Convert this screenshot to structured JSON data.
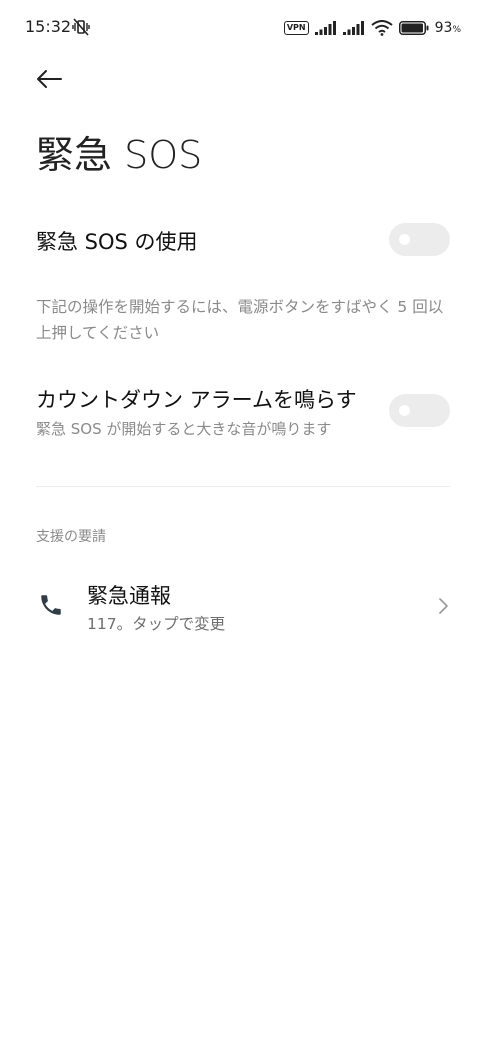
{
  "status_bar": {
    "time": "15:32",
    "vpn": "VPN",
    "battery": "93",
    "battery_unit": "%"
  },
  "header": {
    "title": "緊急 SOS"
  },
  "settings": {
    "use_sos": {
      "label": "緊急 SOS の使用",
      "enabled": false
    },
    "description": "下記の操作を開始するには、電源ボタンをすばやく 5 回以上押してください",
    "countdown": {
      "label": "カウントダウン アラームを鳴らす",
      "sublabel": "緊急 SOS が開始すると大きな音が鳴ります",
      "enabled": false
    }
  },
  "assistance": {
    "section_title": "支援の要請",
    "emergency_call": {
      "label": "緊急通報",
      "sublabel": "117。タップで変更"
    }
  },
  "colors": {
    "toggle_off": "#ececec",
    "secondary_text": "#8a8a8a",
    "primary_text": "#111111"
  }
}
